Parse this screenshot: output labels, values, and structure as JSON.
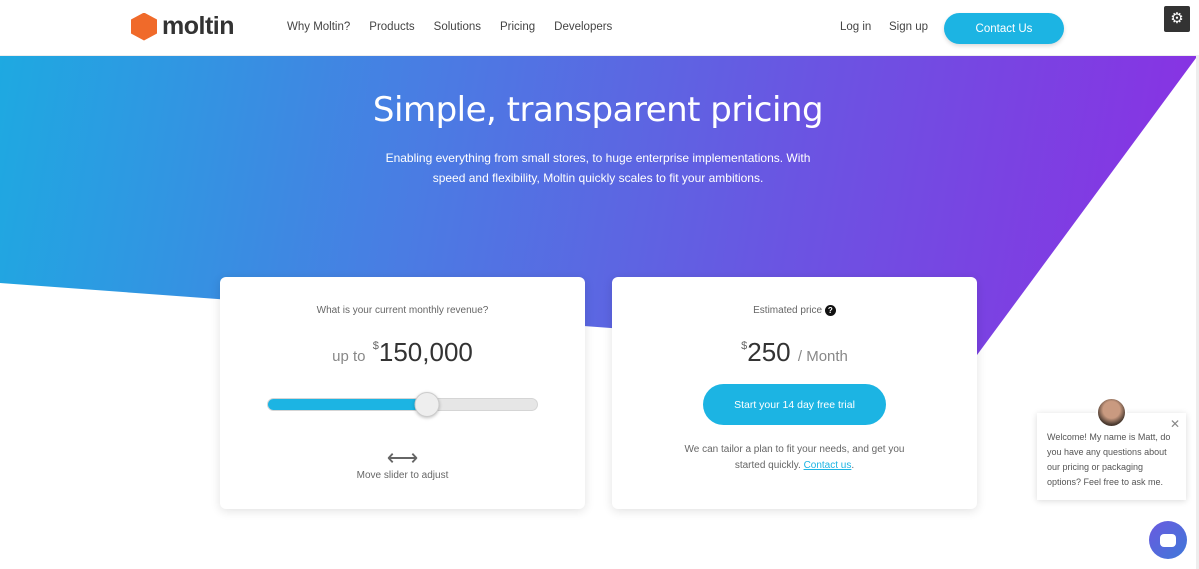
{
  "nav": {
    "logo": "moltin",
    "items": [
      "Why Moltin?",
      "Products",
      "Solutions",
      "Pricing",
      "Developers"
    ],
    "login": "Log in",
    "signup": "Sign up",
    "contact": "Contact Us"
  },
  "hero": {
    "title": "Simple, transparent pricing",
    "subtitle": "Enabling everything from small stores, to huge enterprise implementations. With speed and flexibility, Moltin quickly scales to fit your ambitions."
  },
  "revenue": {
    "question": "What is your current monthly revenue?",
    "prefix": "up to",
    "currency": "$",
    "amount": "150,000",
    "slider_percent": 59,
    "hint": "Move slider to adjust"
  },
  "price": {
    "label": "Estimated price",
    "currency": "$",
    "amount": "250",
    "period": "/ Month",
    "cta": "Start your 14 day free trial",
    "note": "We can tailor a plan to fit your needs, and get you started quickly.",
    "link": "Contact us"
  },
  "chat": {
    "message": "Welcome! My name is Matt, do you have any questions about our pricing or packaging options? Feel free to ask me."
  },
  "colors": {
    "accent": "#1cb4e3",
    "logo": "#f06a2a"
  }
}
